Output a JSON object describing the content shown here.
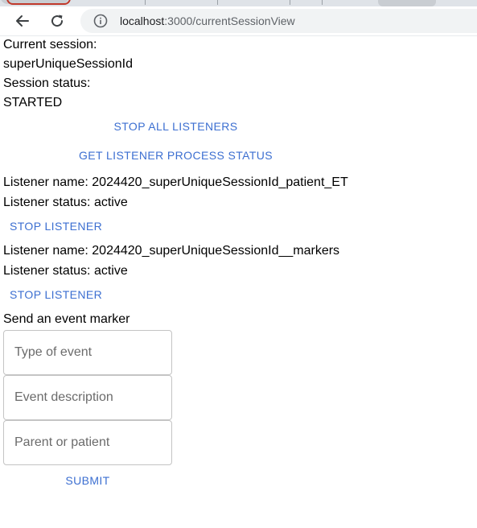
{
  "browser": {
    "url_host": "localhost",
    "url_path": ":3000/currentSessionView"
  },
  "session": {
    "current_label": "Current session:",
    "id": "superUniqueSessionId",
    "status_label": "Session status:",
    "status": "STARTED",
    "stop_all_label": "STOP ALL LISTENERS",
    "get_status_label": "GET LISTENER PROCESS STATUS"
  },
  "listeners": [
    {
      "name_line": "Listener name: 2024420_superUniqueSessionId_patient_ET",
      "status_line": "Listener status: active",
      "stop_label": "STOP LISTENER"
    },
    {
      "name_line": "Listener name: 2024420_superUniqueSessionId__markers",
      "status_line": "Listener status: active",
      "stop_label": "STOP LISTENER"
    }
  ],
  "event_form": {
    "title": "Send an event marker",
    "type_placeholder": "Type of event",
    "description_placeholder": "Event description",
    "parent_placeholder": "Parent or patient",
    "submit_label": "SUBMIT"
  },
  "colors": {
    "accent": "#3c6fd1",
    "field_border": "#c4c4c4",
    "omnibox_bg": "#f1f3f4"
  }
}
